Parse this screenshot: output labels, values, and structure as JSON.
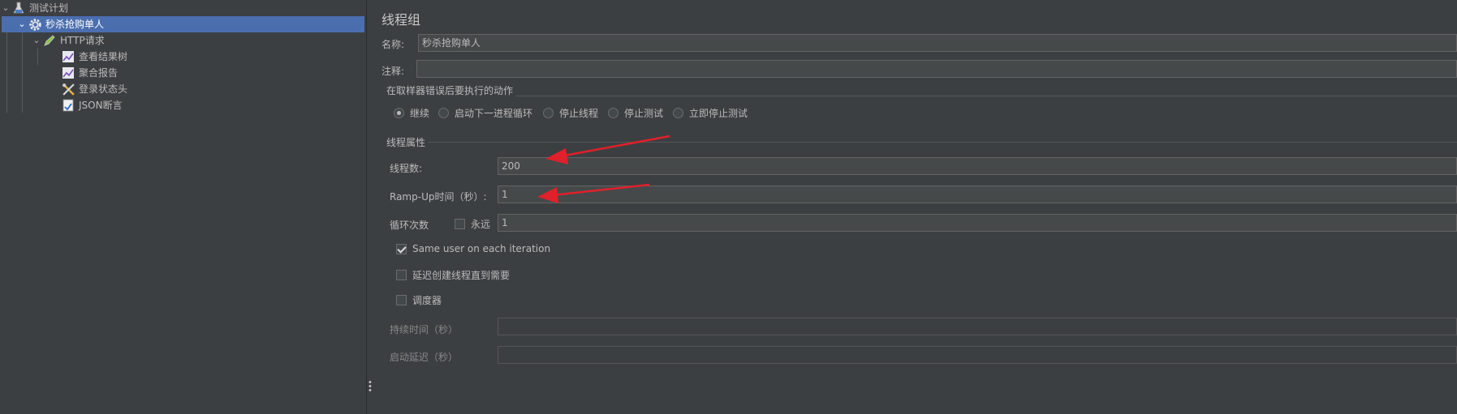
{
  "tree": {
    "items": [
      {
        "label": "测试计划",
        "icon": "test-plan-icon"
      },
      {
        "label": "秒杀抢购单人",
        "icon": "thread-group-gear-icon"
      },
      {
        "label": "HTTP请求",
        "icon": "http-sampler-pen-icon"
      },
      {
        "label": "查看结果树",
        "icon": "listener-chart-icon"
      },
      {
        "label": "聚合报告",
        "icon": "listener-chart-icon"
      },
      {
        "label": "登录状态头",
        "icon": "config-tools-icon"
      },
      {
        "label": "JSON断言",
        "icon": "assertion-icon"
      }
    ]
  },
  "panel": {
    "title": "线程组",
    "name_label": "名称:",
    "name_value": "秒杀抢购单人",
    "comment_label": "注释:",
    "comment_value": "",
    "error_section": {
      "title": "在取样器错误后要执行的动作",
      "options": [
        {
          "label": "继续",
          "selected": true
        },
        {
          "label": "启动下一进程循环",
          "selected": false
        },
        {
          "label": "停止线程",
          "selected": false
        },
        {
          "label": "停止测试",
          "selected": false
        },
        {
          "label": "立即停止测试",
          "selected": false
        }
      ]
    },
    "thread_props": {
      "title": "线程属性",
      "threads_label": "线程数:",
      "threads_value": "200",
      "rampup_label": "Ramp-Up时间（秒）:",
      "rampup_value": "1",
      "loop_label": "循环次数",
      "forever_label": "永远",
      "forever_checked": false,
      "loop_value": "1",
      "same_user_label": "Same user on each iteration",
      "same_user_checked": true,
      "delay_label": "延迟创建线程直到需要",
      "delay_checked": false,
      "scheduler_label": "调度器",
      "scheduler_checked": false,
      "duration_label": "持续时间（秒）",
      "duration_value": "",
      "startup_delay_label": "启动延迟（秒）",
      "startup_delay_value": ""
    }
  },
  "colors": {
    "background": "#3c3f41",
    "selection": "#4b6eaf",
    "annotation_arrow": "#e0202a"
  }
}
